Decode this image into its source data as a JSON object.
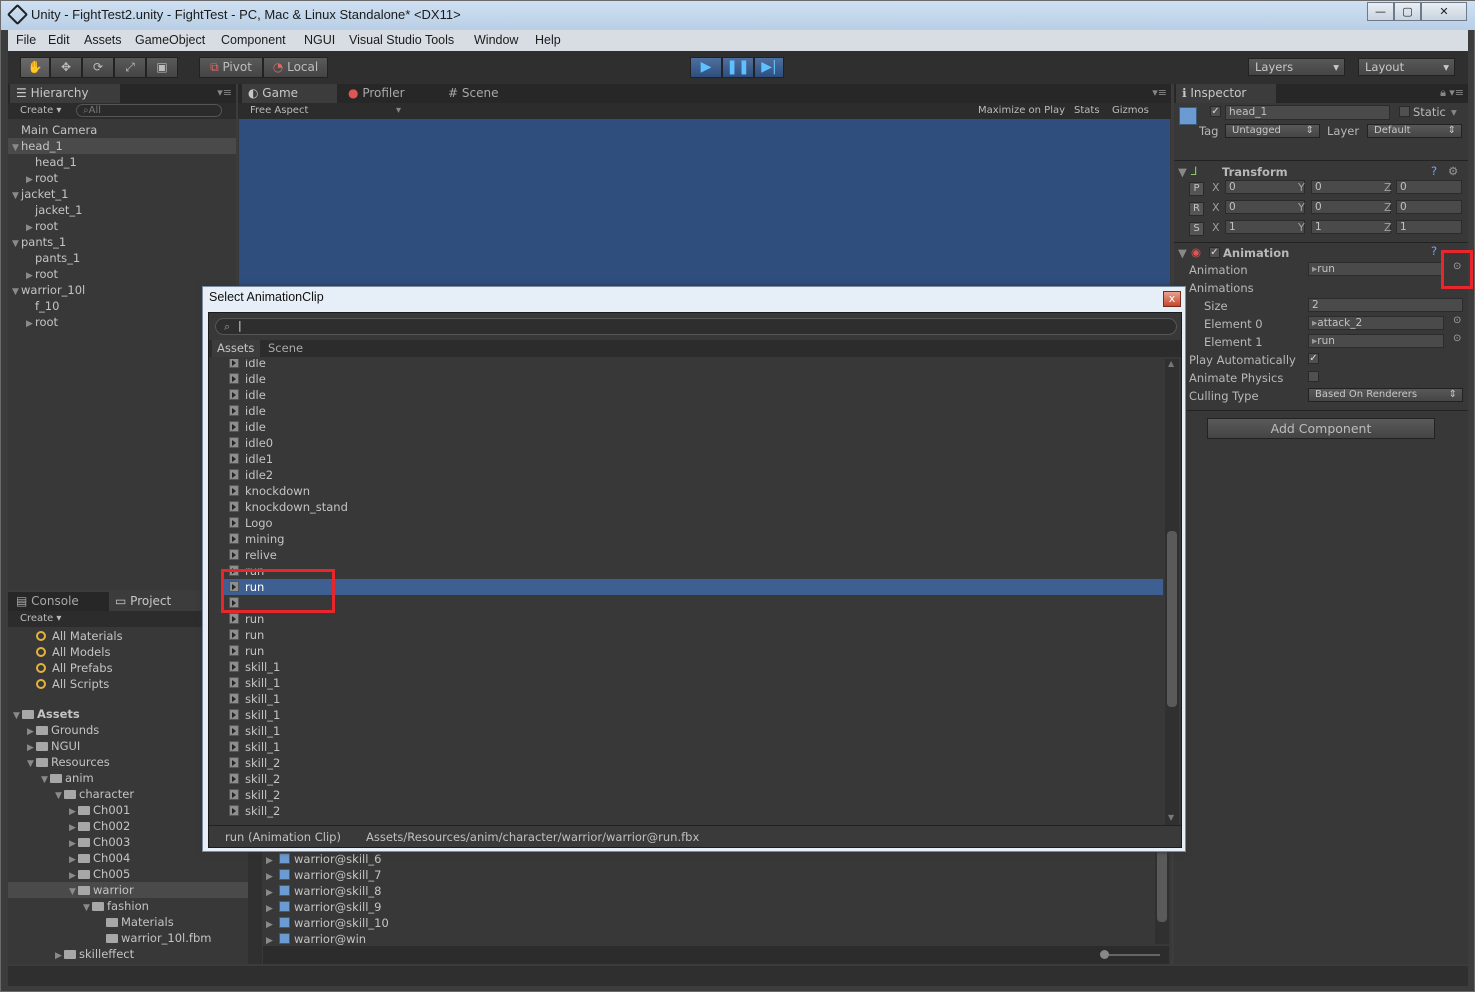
{
  "window": {
    "title": "Unity - FightTest2.unity - FightTest - PC, Mac & Linux Standalone* <DX11>",
    "controls": [
      "—",
      "▢",
      "✕"
    ]
  },
  "menu": [
    "File",
    "Edit",
    "Assets",
    "GameObject",
    "Component",
    "NGUI",
    "Visual Studio Tools",
    "Window",
    "Help"
  ],
  "toolbar": {
    "pivot": "Pivot",
    "local": "Local",
    "layers": "Layers",
    "layout": "Layout"
  },
  "hierarchy": {
    "tab": "Hierarchy",
    "create": "Create",
    "search_placeholder": "All",
    "items": [
      {
        "label": "Main Camera",
        "depth": 0,
        "arrow": ""
      },
      {
        "label": "head_1",
        "depth": 0,
        "arrow": "▼"
      },
      {
        "label": "head_1",
        "depth": 1,
        "arrow": ""
      },
      {
        "label": "root",
        "depth": 1,
        "arrow": "▶"
      },
      {
        "label": "jacket_1",
        "depth": 0,
        "arrow": "▼"
      },
      {
        "label": "jacket_1",
        "depth": 1,
        "arrow": ""
      },
      {
        "label": "root",
        "depth": 1,
        "arrow": "▶"
      },
      {
        "label": "pants_1",
        "depth": 0,
        "arrow": "▼"
      },
      {
        "label": "pants_1",
        "depth": 1,
        "arrow": ""
      },
      {
        "label": "root",
        "depth": 1,
        "arrow": "▶"
      },
      {
        "label": "warrior_10l",
        "depth": 0,
        "arrow": "▼"
      },
      {
        "label": "f_10",
        "depth": 1,
        "arrow": ""
      },
      {
        "label": "root",
        "depth": 1,
        "arrow": "▶"
      }
    ]
  },
  "game": {
    "tabs": [
      "Game",
      "Profiler",
      "Scene"
    ],
    "aspect": "Free Aspect",
    "maximize": "Maximize on Play",
    "stats": "Stats",
    "gizmos": "Gizmos"
  },
  "inspector": {
    "tab": "Inspector",
    "object_name": "head_1",
    "static": "Static",
    "tag_label": "Tag",
    "tag": "Untagged",
    "layer_label": "Layer",
    "layer": "Default",
    "transform": {
      "title": "Transform",
      "rows": [
        {
          "key": "P",
          "x": "0",
          "y": "0",
          "z": "0"
        },
        {
          "key": "R",
          "x": "0",
          "y": "0",
          "z": "0"
        },
        {
          "key": "S",
          "x": "1",
          "y": "1",
          "z": "1"
        }
      ],
      "x_label": "X",
      "y_label": "Y",
      "z_label": "Z"
    },
    "animation": {
      "title": "Animation",
      "animation_label": "Animation",
      "animation_value": "run",
      "animations_label": "Animations",
      "size_label": "Size",
      "size_value": "2",
      "element0_label": "Element 0",
      "element0_value": "attack_2",
      "element1_label": "Element 1",
      "element1_value": "run",
      "play_auto_label": "Play Automatically",
      "animate_physics_label": "Animate Physics",
      "culling_label": "Culling Type",
      "culling_value": "Based On Renderers"
    },
    "add_component": "Add Component"
  },
  "console": {
    "tab": "Console"
  },
  "project": {
    "tab": "Project",
    "create": "Create",
    "favorites": [
      "All Materials",
      "All Models",
      "All Prefabs",
      "All Scripts"
    ],
    "tree": [
      {
        "label": "Assets",
        "depth": 0,
        "arrow": "▼",
        "bold": true
      },
      {
        "label": "Grounds",
        "depth": 1,
        "arrow": "▶"
      },
      {
        "label": "NGUI",
        "depth": 1,
        "arrow": "▶"
      },
      {
        "label": "Resources",
        "depth": 1,
        "arrow": "▼"
      },
      {
        "label": "anim",
        "depth": 2,
        "arrow": "▼"
      },
      {
        "label": "character",
        "depth": 3,
        "arrow": "▼"
      },
      {
        "label": "Ch001",
        "depth": 4,
        "arrow": "▶"
      },
      {
        "label": "Ch002",
        "depth": 4,
        "arrow": "▶"
      },
      {
        "label": "Ch003",
        "depth": 4,
        "arrow": "▶"
      },
      {
        "label": "Ch004",
        "depth": 4,
        "arrow": "▶"
      },
      {
        "label": "Ch005",
        "depth": 4,
        "arrow": "▶"
      },
      {
        "label": "warrior",
        "depth": 4,
        "arrow": "▼",
        "selected": true
      },
      {
        "label": "fashion",
        "depth": 5,
        "arrow": "▼"
      },
      {
        "label": "Materials",
        "depth": 6,
        "arrow": ""
      },
      {
        "label": "warrior_10l.fbm",
        "depth": 6,
        "arrow": ""
      },
      {
        "label": "skilleffect",
        "depth": 3,
        "arrow": "▶"
      }
    ],
    "files": [
      "warrior@skill_6",
      "warrior@skill_7",
      "warrior@skill_8",
      "warrior@skill_9",
      "warrior@skill_10",
      "warrior@win"
    ]
  },
  "dialog": {
    "title": "Select AnimationClip",
    "close": "x",
    "tabs": [
      "Assets",
      "Scene"
    ],
    "items": [
      "idle",
      "idle",
      "idle",
      "idle",
      "idle",
      "idle0",
      "idle1",
      "idle2",
      "knockdown",
      "knockdown_stand",
      "Logo",
      "mining",
      "relive",
      "run",
      "run",
      "",
      "run",
      "run",
      "run",
      "skill_1",
      "skill_1",
      "skill_1",
      "skill_1",
      "skill_1",
      "skill_1",
      "skill_2",
      "skill_2",
      "skill_2",
      "skill_2"
    ],
    "selected_index": 14,
    "status_name": "run (Animation Clip)",
    "status_path": "Assets/Resources/anim/character/warrior/warrior@run.fbx"
  },
  "colors": {
    "selection": "#3d5f92",
    "highlight_box": "#e8262c",
    "game_view": "#2f4d7d"
  }
}
